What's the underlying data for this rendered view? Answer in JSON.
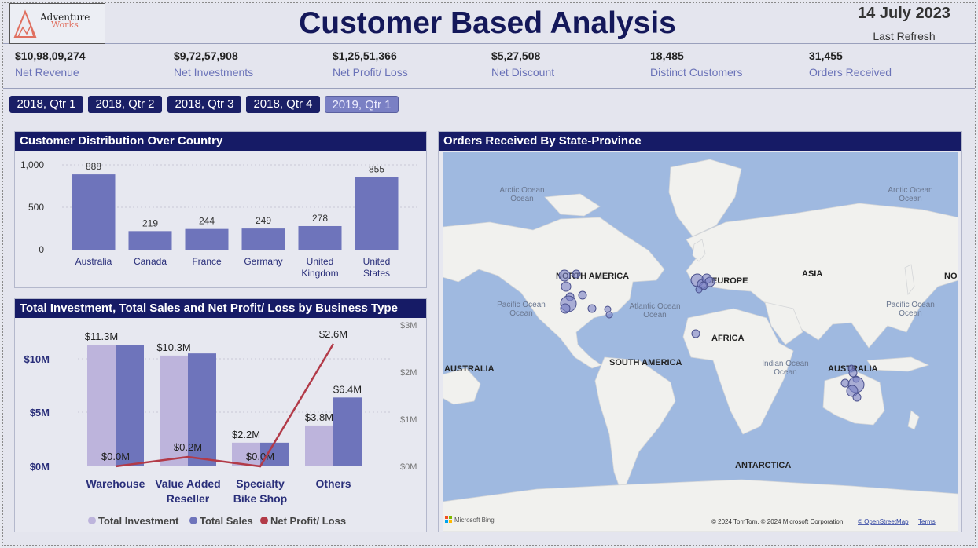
{
  "header": {
    "logo_line1": "Adventure",
    "logo_line2": "Works",
    "title": "Customer Based Analysis",
    "date": "14 July 2023",
    "last_refresh": "Last Refresh"
  },
  "kpis": [
    {
      "value": "$10,98,09,274",
      "label": "Net Revenue"
    },
    {
      "value": "$9,72,57,908",
      "label": "Net Investments"
    },
    {
      "value": "$1,25,51,366",
      "label": "Net Profit/ Loss"
    },
    {
      "value": "$5,27,508",
      "label": "Net Discount"
    },
    {
      "value": "18,485",
      "label": "Distinct Customers"
    },
    {
      "value": "31,455",
      "label": "Orders Received"
    }
  ],
  "slicers": [
    "2018, Qtr 1",
    "2018, Qtr 2",
    "2018, Qtr 3",
    "2018, Qtr 4",
    "2019, Qtr 1"
  ],
  "colors": {
    "navy": "#161b66",
    "bar": "#6e74bb",
    "investment": "#bdb4dc",
    "sales": "#6e74bb",
    "profit": "#b23a48",
    "ocean": "#9fb9e0",
    "land": "#f1f1ee"
  },
  "panels": {
    "country_title": "Customer Distribution Over Country",
    "business_title": "Total Investment, Total Sales and Net Profit/ Loss by Business Type",
    "map_title": "Orders Received By State-Province"
  },
  "chart_data": [
    {
      "type": "bar",
      "categories": [
        "Australia",
        "Canada",
        "France",
        "Germany",
        "United Kingdom",
        "United States"
      ],
      "values": [
        888,
        219,
        244,
        249,
        278,
        855
      ],
      "ylim": [
        0,
        1000
      ],
      "yticks": [
        "1,000",
        "500",
        "0"
      ],
      "title": "Customer Distribution Over Country"
    },
    {
      "type": "bar",
      "categories": [
        "Warehouse",
        "Value Added Reseller",
        "Specialty Bike Shop",
        "Others"
      ],
      "series": [
        {
          "name": "Total Investment",
          "values": [
            11.3,
            10.3,
            2.2,
            3.8
          ]
        },
        {
          "name": "Total Sales",
          "values": [
            11.3,
            10.5,
            2.2,
            6.4
          ]
        },
        {
          "name": "Net Profit/ Loss",
          "values": [
            0.0,
            0.2,
            0.0,
            2.6
          ]
        }
      ],
      "data_labels": {
        "investment": [
          "$11.3M",
          "$10.3M",
          "$2.2M",
          "$3.8M"
        ],
        "sales": [
          "",
          "",
          "",
          "$6.4M"
        ],
        "profit": [
          "$0.0M",
          "$0.2M",
          "$0.0M",
          "$2.6M"
        ]
      },
      "ylim": [
        0,
        13
      ],
      "yticks_left": [
        "$10M",
        "$5M",
        "$0M"
      ],
      "y2lim": [
        0,
        3
      ],
      "yticks_right": [
        "$3M",
        "$2M",
        "$1M",
        "$0M"
      ],
      "title": "Total Investment, Total Sales and Net Profit/ Loss by Business Type"
    }
  ],
  "map": {
    "oceans": [
      "Arctic Ocean",
      "Arctic Ocean",
      "Pacific Ocean",
      "Atlantic Ocean",
      "Indian Ocean",
      "Pacific Ocean"
    ],
    "continents": [
      "NORTH AMERICA",
      "EUROPE",
      "ASIA",
      "AFRICA",
      "SOUTH AMERICA",
      "AUSTRALIA",
      "AUSTRALIA",
      "ANTARCTICA",
      "NO"
    ],
    "brand": "Microsoft Bing",
    "attribution": "© 2024 TomTom, © 2024 Microsoft Corporation,",
    "osm_link": "© OpenStreetMap",
    "terms": "Terms"
  }
}
